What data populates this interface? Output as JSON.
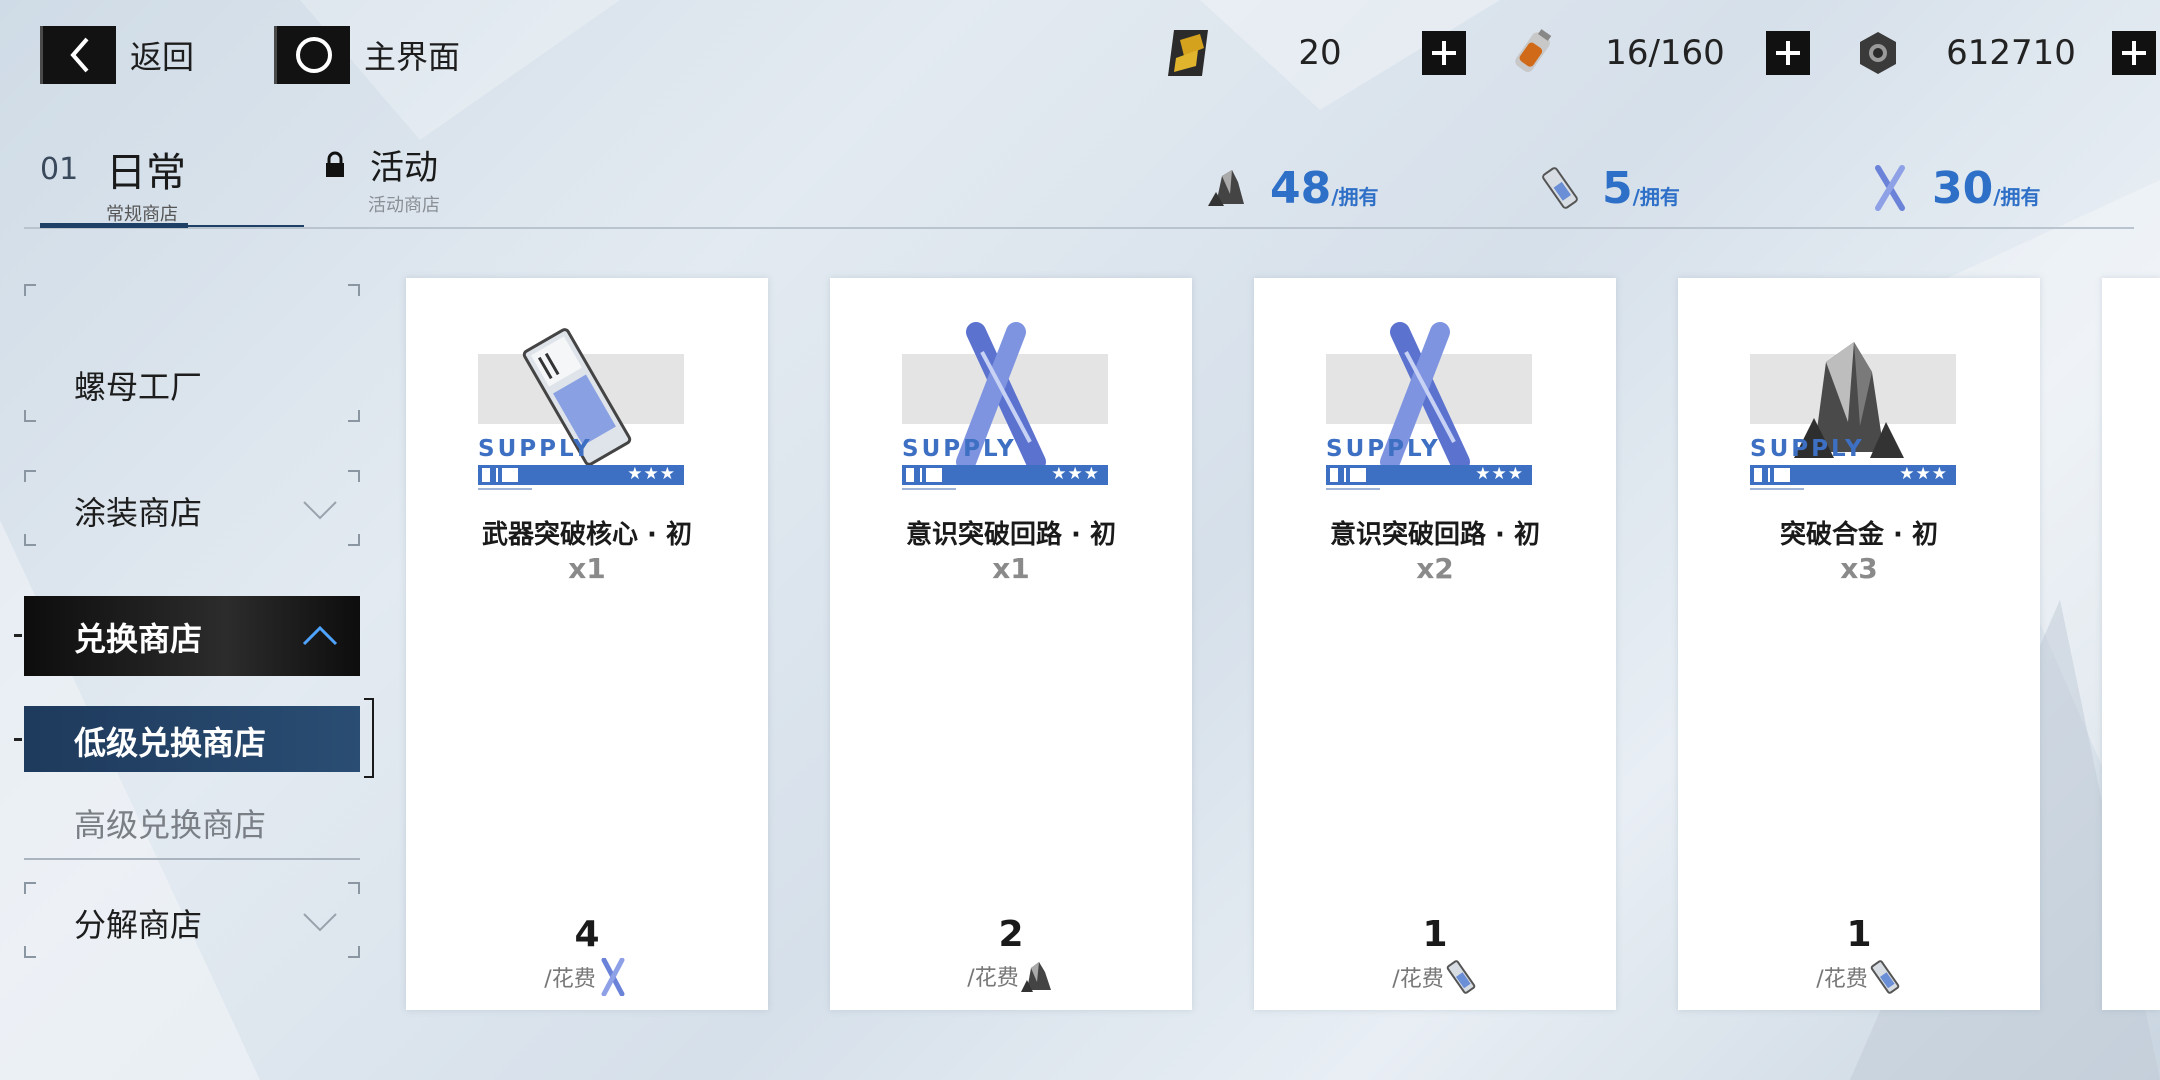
{
  "topbar": {
    "back_label": "返回",
    "home_label": "主界面",
    "resources": [
      {
        "icon": "blackcard-icon",
        "value": "20"
      },
      {
        "icon": "serum-icon",
        "value": "16/160"
      },
      {
        "icon": "coin-nut-icon",
        "value": "612710"
      }
    ]
  },
  "tabs": {
    "daily": {
      "number": "01",
      "label": "日常",
      "sub": "常规商店"
    },
    "event": {
      "label": "活动",
      "sub": "活动商店"
    }
  },
  "owned": {
    "suffix": "/拥有",
    "items": [
      {
        "icon": "alloy-icon",
        "count": "48"
      },
      {
        "icon": "core-vial-icon",
        "count": "5"
      },
      {
        "icon": "circuit-icon",
        "count": "30"
      }
    ]
  },
  "sidebar": {
    "items": [
      {
        "label": "螺母工厂"
      },
      {
        "label": "涂装商店"
      },
      {
        "label": "兑换商店"
      },
      {
        "label": "低级兑换商店"
      },
      {
        "label": "高级兑换商店"
      },
      {
        "label": "分解商店"
      }
    ]
  },
  "cards": [
    {
      "banner": "SUPPLY",
      "stars": "★★★",
      "name": "武器突破核心 · 初",
      "qty": "x1",
      "price": "4",
      "cost_label": "/花费",
      "cost_icon": "circuit-icon",
      "art": "core-vial-icon"
    },
    {
      "banner": "SUPPLY",
      "stars": "★★★",
      "name": "意识突破回路 · 初",
      "qty": "x1",
      "price": "2",
      "cost_label": "/花费",
      "cost_icon": "alloy-icon",
      "art": "circuit-icon"
    },
    {
      "banner": "SUPPLY",
      "stars": "★★★",
      "name": "意识突破回路 · 初",
      "qty": "x2",
      "price": "1",
      "cost_label": "/花费",
      "cost_icon": "core-vial-icon",
      "art": "circuit-icon"
    },
    {
      "banner": "SUPPLY",
      "stars": "★★★",
      "name": "突破合金 · 初",
      "qty": "x3",
      "price": "1",
      "cost_label": "/花费",
      "cost_icon": "core-vial-icon",
      "art": "alloy-icon"
    }
  ],
  "colors": {
    "accent": "#2e6fc7",
    "supply_blue": "#3d6fc2",
    "dark": "#121212",
    "selected": "#1e3a5c"
  }
}
